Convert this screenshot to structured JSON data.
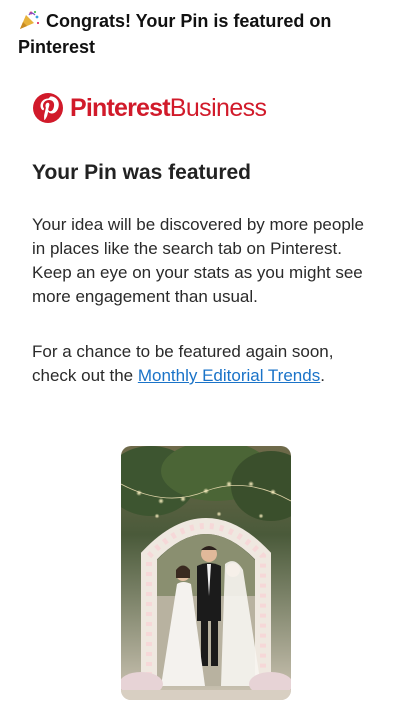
{
  "email": {
    "subject": "Congrats! Your Pin is featured on Pinterest",
    "subject_icon": "party-popper-icon"
  },
  "brand": {
    "logo_icon": "pinterest-logo-icon",
    "name": "Pinterest",
    "suffix": " Business",
    "color": "#d11a2a"
  },
  "content": {
    "headline": "Your Pin was featured",
    "paragraph1": "Your idea will be discovered by more people in places like the search tab on Pinterest. Keep an eye on your stats as you might see more engagement than usual.",
    "paragraph2_before": "For a chance to be featured again soon, check out the ",
    "paragraph2_link": "Monthly Editorial Trends",
    "paragraph2_after": ".",
    "link_color": "#1a73c8"
  },
  "featured_pin": {
    "image_icon": "wedding-photo-image"
  }
}
